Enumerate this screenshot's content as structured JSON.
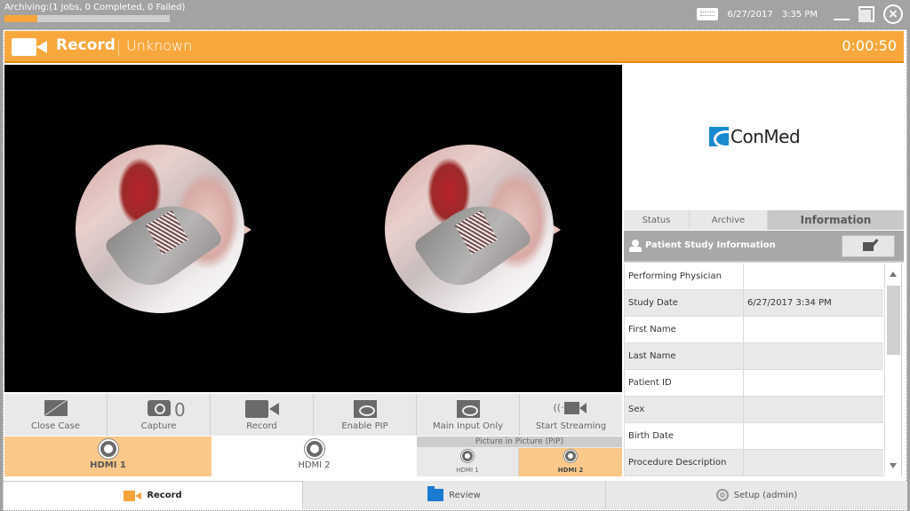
{
  "system_bar": {
    "archive_status": "Archiving:(1 Jobs, 0 Completed, 0 Failed)",
    "archive_progress_percent": 20,
    "date": "6/27/2017",
    "time": "3:35 PM",
    "icons": [
      "keyboard-icon",
      "minimize-icon",
      "restore-icon",
      "close-icon"
    ]
  },
  "header": {
    "title": "Record",
    "subtitle": "Unknown",
    "timer": "0:00:50",
    "accent_color": "#f7a73c"
  },
  "logo": {
    "text": "ConMed"
  },
  "side_tabs": [
    {
      "label": "Status",
      "active": false
    },
    {
      "label": "Archive",
      "active": false
    },
    {
      "label": "Information",
      "active": true
    }
  ],
  "patient_panel": {
    "title": "Patient Study Information",
    "edit_icon": "edit-icon",
    "rows": [
      {
        "label": "Performing Physician",
        "value": ""
      },
      {
        "label": "Study Date",
        "value": "6/27/2017 3:34 PM"
      },
      {
        "label": "First Name",
        "value": ""
      },
      {
        "label": "Last Name",
        "value": ""
      },
      {
        "label": "Patient ID",
        "value": ""
      },
      {
        "label": "Sex",
        "value": ""
      },
      {
        "label": "Birth Date",
        "value": ""
      },
      {
        "label": "Procedure Description",
        "value": ""
      }
    ]
  },
  "controls": {
    "close_case": "Close Case",
    "capture": "Capture",
    "capture_count": "0",
    "record": "Record",
    "enable_pip": "Enable PIP",
    "main_input_only": "Main Input Only",
    "start_streaming": "Start Streaming"
  },
  "inputs": {
    "main": [
      {
        "label": "HDMI 1",
        "selected": true
      },
      {
        "label": "HDMI 2",
        "selected": false
      }
    ],
    "pip_header": "Picture in Picture (PIP)",
    "pip": [
      {
        "label": "HDMI 1",
        "selected": false
      },
      {
        "label": "HDMI 2",
        "selected": true
      }
    ]
  },
  "bottom_nav": [
    {
      "label": "Record",
      "icon": "video-camera-icon",
      "active": true
    },
    {
      "label": "Review",
      "icon": "folder-icon",
      "active": false
    },
    {
      "label": "Setup (admin)",
      "icon": "gear-icon",
      "active": false
    }
  ]
}
